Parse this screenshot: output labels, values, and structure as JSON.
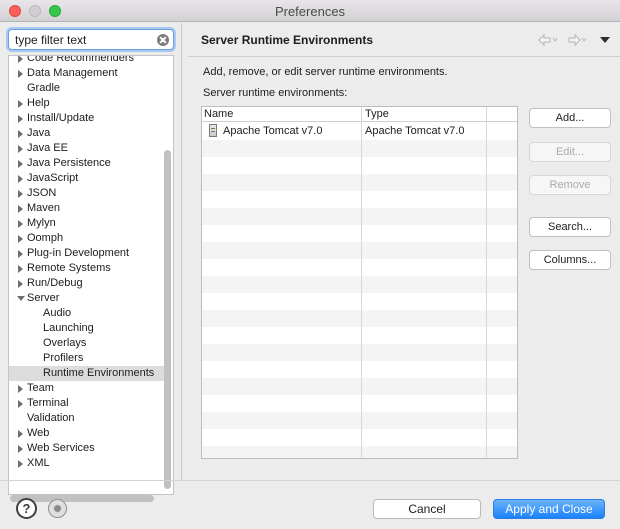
{
  "window": {
    "title": "Preferences"
  },
  "filter": {
    "value": "type filter text"
  },
  "tree": {
    "items": [
      {
        "label": "Code Recommenders",
        "level": 0,
        "expandable": true,
        "expanded": false
      },
      {
        "label": "Data Management",
        "level": 0,
        "expandable": true,
        "expanded": false
      },
      {
        "label": "Gradle",
        "level": 0,
        "expandable": false
      },
      {
        "label": "Help",
        "level": 0,
        "expandable": true,
        "expanded": false
      },
      {
        "label": "Install/Update",
        "level": 0,
        "expandable": true,
        "expanded": false
      },
      {
        "label": "Java",
        "level": 0,
        "expandable": true,
        "expanded": false
      },
      {
        "label": "Java EE",
        "level": 0,
        "expandable": true,
        "expanded": false
      },
      {
        "label": "Java Persistence",
        "level": 0,
        "expandable": true,
        "expanded": false
      },
      {
        "label": "JavaScript",
        "level": 0,
        "expandable": true,
        "expanded": false
      },
      {
        "label": "JSON",
        "level": 0,
        "expandable": true,
        "expanded": false
      },
      {
        "label": "Maven",
        "level": 0,
        "expandable": true,
        "expanded": false
      },
      {
        "label": "Mylyn",
        "level": 0,
        "expandable": true,
        "expanded": false
      },
      {
        "label": "Oomph",
        "level": 0,
        "expandable": true,
        "expanded": false
      },
      {
        "label": "Plug-in Development",
        "level": 0,
        "expandable": true,
        "expanded": false
      },
      {
        "label": "Remote Systems",
        "level": 0,
        "expandable": true,
        "expanded": false
      },
      {
        "label": "Run/Debug",
        "level": 0,
        "expandable": true,
        "expanded": false
      },
      {
        "label": "Server",
        "level": 0,
        "expandable": true,
        "expanded": true
      },
      {
        "label": "Audio",
        "level": 1,
        "expandable": false
      },
      {
        "label": "Launching",
        "level": 1,
        "expandable": false
      },
      {
        "label": "Overlays",
        "level": 1,
        "expandable": false
      },
      {
        "label": "Profilers",
        "level": 1,
        "expandable": false
      },
      {
        "label": "Runtime Environments",
        "level": 1,
        "expandable": false,
        "selected": true
      },
      {
        "label": "Team",
        "level": 0,
        "expandable": true,
        "expanded": false
      },
      {
        "label": "Terminal",
        "level": 0,
        "expandable": true,
        "expanded": false
      },
      {
        "label": "Validation",
        "level": 0,
        "expandable": false
      },
      {
        "label": "Web",
        "level": 0,
        "expandable": true,
        "expanded": false
      },
      {
        "label": "Web Services",
        "level": 0,
        "expandable": true,
        "expanded": false
      },
      {
        "label": "XML",
        "level": 0,
        "expandable": true,
        "expanded": false
      }
    ]
  },
  "page": {
    "title": "Server Runtime Environments",
    "description": "Add, remove, or edit server runtime environments.",
    "list_label": "Server runtime environments:",
    "columns": {
      "name": "Name",
      "type": "Type"
    },
    "rows": [
      {
        "name": "Apache Tomcat v7.0",
        "type": "Apache Tomcat v7.0",
        "icon": "server-icon"
      }
    ],
    "buttons": {
      "add": "Add...",
      "edit": "Edit...",
      "remove": "Remove",
      "search": "Search...",
      "columns": "Columns..."
    }
  },
  "footer": {
    "help_glyph": "?",
    "cancel": "Cancel",
    "apply_close": "Apply and Close"
  },
  "colors": {
    "accent": "#1a82fb",
    "selection": "#dcdcdc",
    "close": "#fc5f57",
    "maximize": "#34c84a"
  }
}
